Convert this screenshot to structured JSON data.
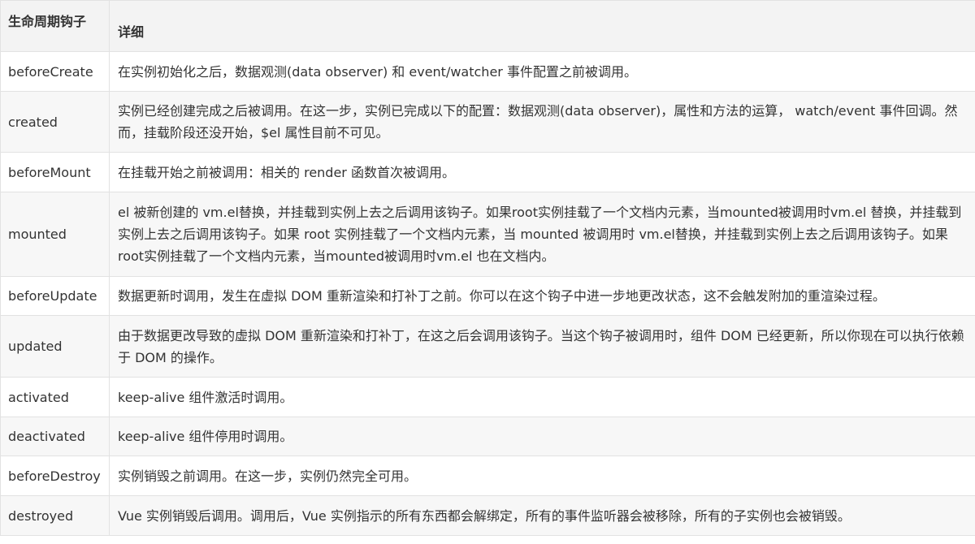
{
  "table": {
    "headers": [
      "生命周期钩子",
      "详细"
    ],
    "rows": [
      {
        "hook": "beforeCreate",
        "detail": "在实例初始化之后，数据观测(data observer) 和 event/watcher 事件配置之前被调用。"
      },
      {
        "hook": "created",
        "detail": "实例已经创建完成之后被调用。在这一步，实例已完成以下的配置：数据观测(data observer)，属性和方法的运算， watch/event 事件回调。然而，挂载阶段还没开始，$el 属性目前不可见。"
      },
      {
        "hook": "beforeMount",
        "detail": "在挂载开始之前被调用：相关的 render 函数首次被调用。"
      },
      {
        "hook": "mounted",
        "detail": "el 被新创建的 vm.el替换，并挂载到实例上去之后调用该钩子。如果root实例挂载了一个文档内元素，当mounted被调用时vm.el 替换，并挂载到实例上去之后调用该钩子。如果 root 实例挂载了一个文档内元素，当 mounted 被调用时 vm.el替换，并挂载到实例上去之后调用该钩子。如果root实例挂载了一个文档内元素，当mounted被调用时vm.el 也在文档内。"
      },
      {
        "hook": "beforeUpdate",
        "detail": "数据更新时调用，发生在虚拟 DOM 重新渲染和打补丁之前。你可以在这个钩子中进一步地更改状态，这不会触发附加的重渲染过程。"
      },
      {
        "hook": "updated",
        "detail": "由于数据更改导致的虚拟 DOM 重新渲染和打补丁，在这之后会调用该钩子。当这个钩子被调用时，组件 DOM 已经更新，所以你现在可以执行依赖于 DOM 的操作。"
      },
      {
        "hook": "activated",
        "detail": "keep-alive 组件激活时调用。"
      },
      {
        "hook": "deactivated",
        "detail": "keep-alive 组件停用时调用。"
      },
      {
        "hook": "beforeDestroy",
        "detail": "实例销毁之前调用。在这一步，实例仍然完全可用。"
      },
      {
        "hook": "destroyed",
        "detail": "Vue 实例销毁后调用。调用后，Vue 实例指示的所有东西都会解绑定，所有的事件监听器会被移除，所有的子实例也会被销毁。"
      }
    ]
  }
}
